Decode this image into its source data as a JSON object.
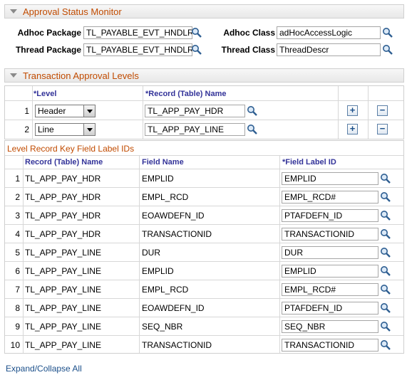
{
  "approval_status_monitor": {
    "title": "Approval Status Monitor",
    "adhoc_package_label": "Adhoc Package",
    "adhoc_package_value": "TL_PAYABLE_EVT_HNDLR",
    "adhoc_class_label": "Adhoc Class",
    "adhoc_class_value": "adHocAccessLogic",
    "thread_package_label": "Thread Package",
    "thread_package_value": "TL_PAYABLE_EVT_HNDLR",
    "thread_class_label": "Thread Class",
    "thread_class_value": "ThreadDescr"
  },
  "transaction_approval_levels": {
    "title": "Transaction Approval Levels",
    "col_level": "*Level",
    "col_record": "*Record (Table) Name",
    "rows": [
      {
        "num": "1",
        "level": "Header",
        "record": "TL_APP_PAY_HDR"
      },
      {
        "num": "2",
        "level": "Line",
        "record": "TL_APP_PAY_LINE"
      }
    ],
    "add_symbol": "+",
    "remove_symbol": "−"
  },
  "level_record_key": {
    "title": "Level Record Key Field Label IDs",
    "col_record": "Record (Table) Name",
    "col_field": "Field Name",
    "col_label": "*Field Label ID",
    "rows": [
      {
        "num": "1",
        "record": "TL_APP_PAY_HDR",
        "field": "EMPLID",
        "label": "EMPLID"
      },
      {
        "num": "2",
        "record": "TL_APP_PAY_HDR",
        "field": "EMPL_RCD",
        "label": "EMPL_RCD#"
      },
      {
        "num": "3",
        "record": "TL_APP_PAY_HDR",
        "field": "EOAWDEFN_ID",
        "label": "PTAFDEFN_ID"
      },
      {
        "num": "4",
        "record": "TL_APP_PAY_HDR",
        "field": "TRANSACTIONID",
        "label": "TRANSACTIONID"
      },
      {
        "num": "5",
        "record": "TL_APP_PAY_LINE",
        "field": "DUR",
        "label": "DUR"
      },
      {
        "num": "6",
        "record": "TL_APP_PAY_LINE",
        "field": "EMPLID",
        "label": "EMPLID"
      },
      {
        "num": "7",
        "record": "TL_APP_PAY_LINE",
        "field": "EMPL_RCD",
        "label": "EMPL_RCD#"
      },
      {
        "num": "8",
        "record": "TL_APP_PAY_LINE",
        "field": "EOAWDEFN_ID",
        "label": "PTAFDEFN_ID"
      },
      {
        "num": "9",
        "record": "TL_APP_PAY_LINE",
        "field": "SEQ_NBR",
        "label": "SEQ_NBR"
      },
      {
        "num": "10",
        "record": "TL_APP_PAY_LINE",
        "field": "TRANSACTIONID",
        "label": "TRANSACTIONID"
      }
    ]
  },
  "footer": {
    "expand_collapse_all": "Expand/Collapse All"
  },
  "colors": {
    "section_title": "#c14b00",
    "column_header": "#333399",
    "link": "#1b4f8a"
  }
}
